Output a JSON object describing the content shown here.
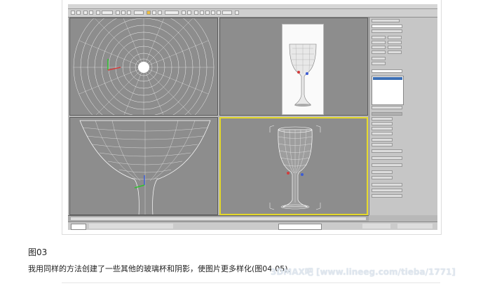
{
  "figure": {
    "caption": "图03",
    "text": "我用同样的方法创建了一些其他的玻璃杯和阴影，使图片更多样化(图04-05)。",
    "watermark": "3DMAX吧 [www.lineeg.com/tieba/1771]"
  },
  "screenshot": {
    "app": "3ds Max",
    "viewports": [
      "top-view",
      "front-view",
      "left-view",
      "perspective-view"
    ],
    "active_viewport": "perspective-view",
    "colors": {
      "viewport_bg": "#8d8d8d",
      "wireframe": "#ffffff",
      "active_border": "#e4d82a",
      "panel_bg": "#c6c6c6"
    }
  }
}
